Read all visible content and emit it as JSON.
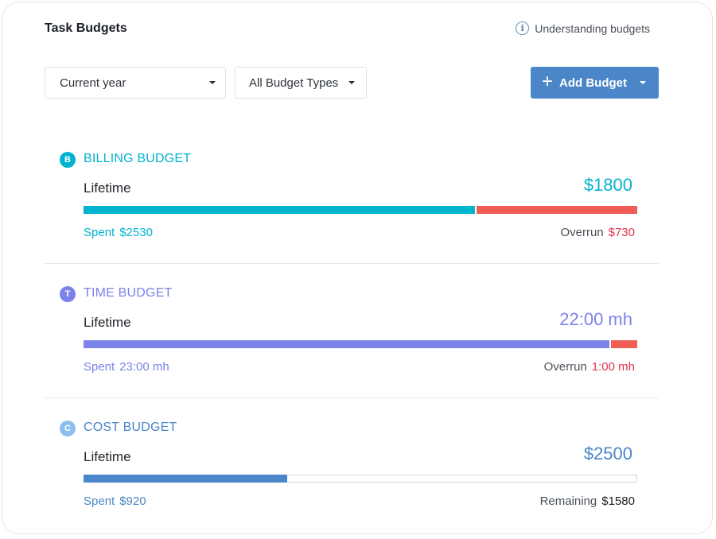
{
  "header": {
    "title": "Task Budgets",
    "help_label": "Understanding budgets"
  },
  "filters": {
    "period": "Current year",
    "type": "All Budget Types"
  },
  "add_button": {
    "label": "Add Budget"
  },
  "budgets": [
    {
      "badge": "B",
      "type_label": "BILLING BUDGET",
      "period": "Lifetime",
      "amount": "$1800",
      "spent_label": "Spent",
      "spent_value": "$2530",
      "right_label": "Overrun",
      "right_value": "$730",
      "primary_fraction": 0.709,
      "secondary_fraction": 0.291,
      "secondary_kind": "overrun",
      "color": "#00b3cf",
      "overrun_color": "#ef5d55",
      "overrun_text_color": "#e0324f"
    },
    {
      "badge": "T",
      "type_label": "TIME BUDGET",
      "period": "Lifetime",
      "amount": "22:00 mh",
      "spent_label": "Spent",
      "spent_value": "23:00 mh",
      "right_label": "Overrun",
      "right_value": "1:00 mh",
      "primary_fraction": 0.952,
      "secondary_fraction": 0.048,
      "secondary_kind": "overrun",
      "color": "#7b83e8",
      "overrun_color": "#ef5d55",
      "overrun_text_color": "#e0324f"
    },
    {
      "badge": "C",
      "type_label": "COST BUDGET",
      "period": "Lifetime",
      "amount": "$2500",
      "spent_label": "Spent",
      "spent_value": "$920",
      "right_label": "Remaining",
      "right_value": "$1580",
      "primary_fraction": 0.368,
      "secondary_fraction": 0.632,
      "secondary_kind": "remaining",
      "color": "#4a86c8",
      "badge_color": "#8cbfef",
      "remaining_text_color": "#1b1f24"
    }
  ]
}
